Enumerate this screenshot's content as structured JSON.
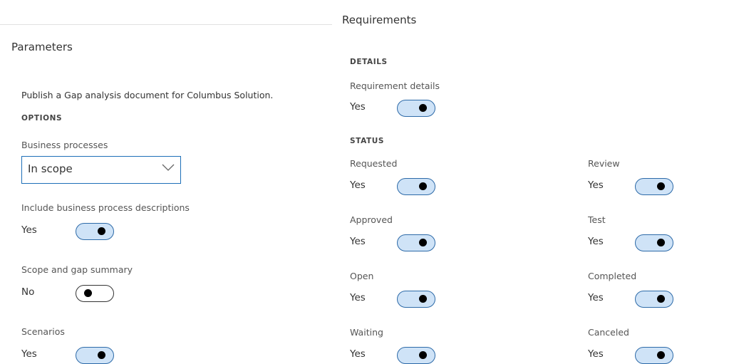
{
  "parameters": {
    "title": "Parameters",
    "description": "Publish a Gap analysis document for Columbus Solution.",
    "options_header": "OPTIONS",
    "business_processes": {
      "label": "Business processes",
      "value": "In scope"
    },
    "include_descriptions": {
      "label": "Include business process descriptions",
      "value": "Yes",
      "on": true
    },
    "scope_gap_summary": {
      "label": "Scope and gap summary",
      "value": "No",
      "on": false
    },
    "scenarios": {
      "label": "Scenarios",
      "value": "Yes",
      "on": true
    }
  },
  "requirements": {
    "title": "Requirements",
    "details_header": "DETAILS",
    "requirement_details": {
      "label": "Requirement details",
      "value": "Yes",
      "on": true
    },
    "status_header": "STATUS",
    "requested": {
      "label": "Requested",
      "value": "Yes",
      "on": true
    },
    "approved": {
      "label": "Approved",
      "value": "Yes",
      "on": true
    },
    "open": {
      "label": "Open",
      "value": "Yes",
      "on": true
    },
    "waiting": {
      "label": "Waiting",
      "value": "Yes",
      "on": true
    },
    "review": {
      "label": "Review",
      "value": "Yes",
      "on": true
    },
    "test": {
      "label": "Test",
      "value": "Yes",
      "on": true
    },
    "completed": {
      "label": "Completed",
      "value": "Yes",
      "on": true
    },
    "canceled": {
      "label": "Canceled",
      "value": "Yes",
      "on": true
    }
  },
  "colors": {
    "toggle_on_fill": "#cfe3f7",
    "toggle_border": "#2d6aa8",
    "select_border": "#1e6fb8"
  },
  "icons": {
    "dropdown": "chevron-down-icon"
  }
}
